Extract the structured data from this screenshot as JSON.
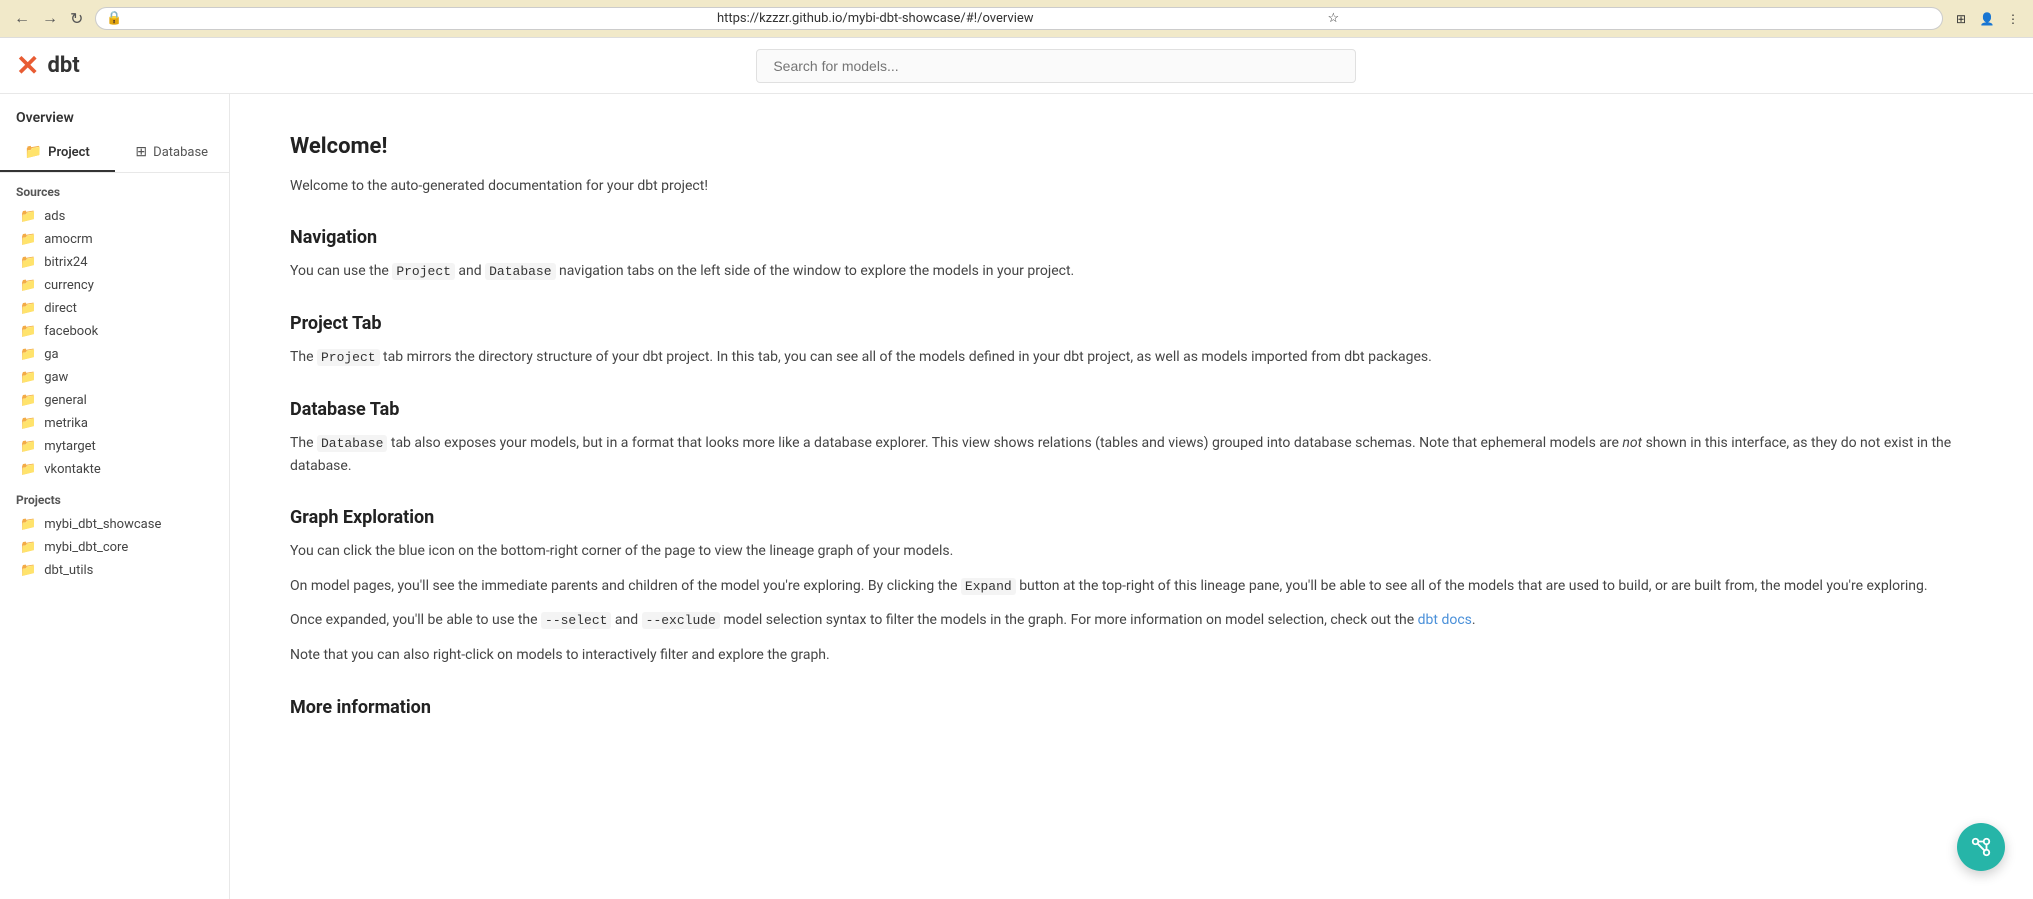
{
  "browser": {
    "url": "https://kzzzr.github.io/mybi-dbt-showcase/#!/overview",
    "back_disabled": false,
    "forward_disabled": false
  },
  "header": {
    "logo_text": "dbt",
    "search_placeholder": "Search for models..."
  },
  "sidebar": {
    "overview_label": "Overview",
    "tab_project": "Project",
    "tab_database": "Database",
    "sources_section": "Sources",
    "sources": [
      "ads",
      "amocrm",
      "bitrix24",
      "currency",
      "direct",
      "facebook",
      "ga",
      "gaw",
      "general",
      "metrika",
      "mytarget",
      "vkontakte"
    ],
    "projects_section": "Projects",
    "projects": [
      "mybi_dbt_showcase",
      "mybi_dbt_core",
      "dbt_utils"
    ]
  },
  "main": {
    "welcome_heading": "Welcome!",
    "welcome_text": "Welcome to the auto-generated documentation for your dbt project!",
    "navigation_heading": "Navigation",
    "navigation_text_before": "You can use the ",
    "navigation_project_code": "Project",
    "navigation_text_mid": " and ",
    "navigation_database_code": "Database",
    "navigation_text_after": " navigation tabs on the left side of the window to explore the models in your project.",
    "project_tab_heading": "Project Tab",
    "project_tab_text_before": "The ",
    "project_tab_code": "Project",
    "project_tab_text_after": " tab mirrors the directory structure of your dbt project. In this tab, you can see all of the models defined in your dbt project, as well as models imported from dbt packages.",
    "database_tab_heading": "Database Tab",
    "database_tab_text_before": "The ",
    "database_tab_code": "Database",
    "database_tab_text_after": " tab also exposes your models, but in a format that looks more like a database explorer. This view shows relations (tables and views) grouped into database schemas. Note that ephemeral models are ",
    "database_tab_italic": "not",
    "database_tab_text_end": " shown in this interface, as they do not exist in the database.",
    "graph_heading": "Graph Exploration",
    "graph_text1": "You can click the blue icon on the bottom-right corner of the page to view the lineage graph of your models.",
    "graph_text2_before": "On model pages, you'll see the immediate parents and children of the model you're exploring. By clicking the ",
    "graph_expand_code": "Expand",
    "graph_text2_after": " button at the top-right of this lineage pane, you'll be able to see all of the models that are used to build, or are built from, the model you're exploring.",
    "graph_text3_before": "Once expanded, you'll be able to use the ",
    "graph_select_code": "--select",
    "graph_text3_mid": " and ",
    "graph_exclude_code": "--exclude",
    "graph_text3_after": " model selection syntax to filter the models in the graph. For more information on model selection, check out the ",
    "graph_link_text": "dbt docs",
    "graph_text3_end": ".",
    "graph_text4": "Note that you can also right-click on models to interactively filter and explore the graph.",
    "more_info_heading": "More information"
  }
}
